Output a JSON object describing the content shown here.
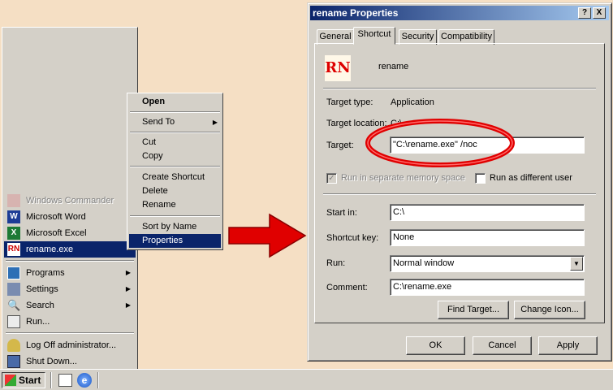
{
  "start_menu": {
    "recent": [
      {
        "label": "Windows Commander",
        "icon": "windows-commander-icon",
        "disabled": true
      },
      {
        "label": "Microsoft Word",
        "icon": "word-icon"
      },
      {
        "label": "Microsoft Excel",
        "icon": "excel-icon"
      },
      {
        "label": "rename.exe",
        "icon": "rename-app-icon",
        "selected": true
      }
    ],
    "items": [
      {
        "label": "Programs",
        "icon": "programs-icon",
        "submenu": true
      },
      {
        "label": "Settings",
        "icon": "settings-icon",
        "submenu": true
      },
      {
        "label": "Search",
        "icon": "search-icon",
        "submenu": true
      },
      {
        "label": "Run...",
        "icon": "run-icon"
      }
    ],
    "logoff": {
      "label": "Log Off administrator...",
      "icon": "key-icon"
    },
    "shutdown": {
      "label": "Shut Down...",
      "icon": "shutdown-icon"
    }
  },
  "context_menu": {
    "open": "Open",
    "send_to": "Send To",
    "cut": "Cut",
    "copy": "Copy",
    "create_shortcut": "Create Shortcut",
    "delete": "Delete",
    "rename": "Rename",
    "sort_by_name": "Sort by Name",
    "properties": "Properties"
  },
  "taskbar": {
    "start_label": "Start"
  },
  "dialog": {
    "title": "rename Properties",
    "help_btn": "?",
    "close_btn": "X",
    "tabs": [
      "General",
      "Shortcut",
      "Security",
      "Compatibility"
    ],
    "active_tab": "Shortcut",
    "app_name": "rename",
    "target_type_label": "Target type:",
    "target_type_value": "Application",
    "target_location_label": "Target location:",
    "target_location_value": "C:\\",
    "target_label": "Target:",
    "target_value": "\"C:\\rename.exe\" /noc",
    "separate_memory_label": "Run in separate memory space",
    "different_user_label": "Run as different user",
    "start_in_label": "Start in:",
    "start_in_value": "C:\\",
    "shortcut_key_label": "Shortcut key:",
    "shortcut_key_value": "None",
    "run_label": "Run:",
    "run_value": "Normal window",
    "comment_label": "Comment:",
    "comment_value": "C:\\rename.exe",
    "find_target_btn": "Find Target...",
    "change_icon_btn": "Change Icon...",
    "ok_btn": "OK",
    "cancel_btn": "Cancel",
    "apply_btn": "Apply"
  },
  "colors": {
    "highlight": "#0a246a",
    "annotation_red": "#e00000",
    "background": "#f5dfc4"
  }
}
